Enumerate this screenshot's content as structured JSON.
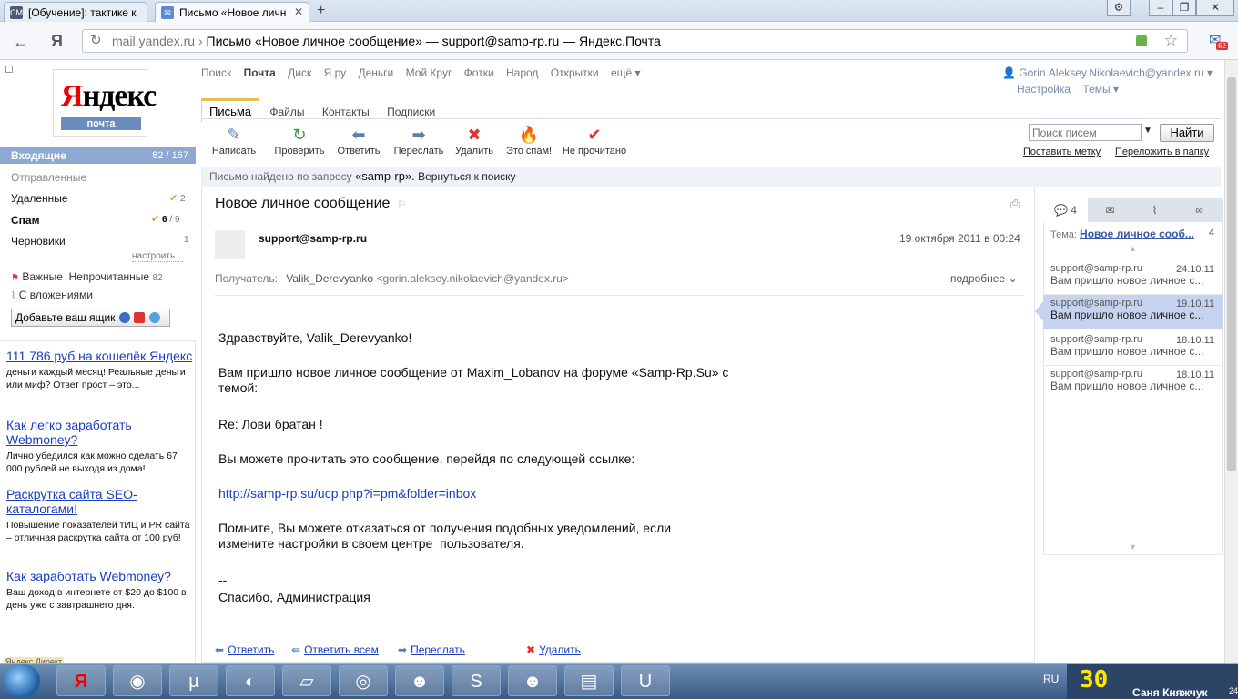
{
  "browser": {
    "tabs": [
      {
        "label": "[Обучение]: тактике к",
        "favicon": "СМ"
      },
      {
        "label": "Письмо «Новое личн",
        "favicon": "mail"
      }
    ],
    "url_host": "mail.yandex.ru",
    "url_title": "Письмо «Новое личное сообщение» — support@samp-rp.ru — Яндекс.Почта",
    "ext_count": "62"
  },
  "logo": {
    "word": "Яндекс",
    "first_letter": "Я",
    "rest": "ндекс",
    "sub": "почта"
  },
  "topnav": [
    "Поиск",
    "Почта",
    "Диск",
    "Я.ру",
    "Деньги",
    "Мой Круг",
    "Фотки",
    "Народ",
    "Открытки",
    "ещё ▾"
  ],
  "account": {
    "email": "Gorin.Aleksey.Nikolaevich@yandex.ru ▾",
    "settings": "Настройка",
    "themes": "Темы ▾"
  },
  "subtabs": [
    "Письма",
    "Файлы",
    "Контакты",
    "Подписки"
  ],
  "toolbar": [
    {
      "label": "Написать",
      "icon": "compose-icon"
    },
    {
      "label": "Проверить",
      "icon": "refresh-icon"
    },
    {
      "label": "Ответить",
      "icon": "reply-icon"
    },
    {
      "label": "Переслать",
      "icon": "forward-icon"
    },
    {
      "label": "Удалить",
      "icon": "delete-icon"
    },
    {
      "label": "Это спам!",
      "icon": "spam-icon"
    },
    {
      "label": "Не прочитано",
      "icon": "unread-icon"
    }
  ],
  "search": {
    "placeholder": "Поиск писем",
    "button": "Найти"
  },
  "toolbar_links": {
    "label": "Поставить метку",
    "move": "Переложить в папку"
  },
  "sidebar": {
    "inbox": {
      "label": "Входящие",
      "count": "82 / 167"
    },
    "sent": "Отправленные",
    "deleted": {
      "label": "Удаленные",
      "count": "2"
    },
    "spam": {
      "label": "Спам",
      "new": "6",
      "total": "/ 9"
    },
    "drafts": {
      "label": "Черновики",
      "count": "1"
    },
    "setup": "настроить...",
    "important": "Важные",
    "unread": "Непрочитанные",
    "unread_count": "82",
    "attachments": "С вложениями",
    "add_box": "Добавьте ваш ящик"
  },
  "ads": [
    {
      "title": "111 786 руб на кошелёк Яндекс",
      "text": "деньги каждый месяц! Реальные деньги или миф? Ответ прост – это..."
    },
    {
      "title": "Как легко заработать Webmoney?",
      "text": "Лично убедился как можно сделать 67 000 рублей не выходя из дома!"
    },
    {
      "title": "Раскрутка сайта SEO-каталогами!",
      "text": "Повышение показателей тИЦ и PR сайта – отличная раскрутка сайта от 100 руб!"
    },
    {
      "title": "Как заработать Webmoney?",
      "text": "Ваш доход в интернете от $20 до $100 в день уже с завтрашнего дня."
    }
  ],
  "ads_footer": "Яндекс.Директ",
  "found": {
    "prefix": "Письмо найдено по запросу",
    "query": "«samp-rp».",
    "back": "Вернуться к поиску"
  },
  "message": {
    "subject": "Новое личное сообщение",
    "from": "support@samp-rp.ru",
    "date": "19 октября 2011 в 00:24",
    "recipient_label": "Получатель:",
    "recipient_name": "Valik_Derevyanko",
    "recipient_email": "<gorin.aleksey.nikolaevich@yandex.ru>",
    "more": "подробнее ⌄",
    "greeting": "Здравствуйте, Valik_Derevyanko!",
    "line1": "Вам пришло новое личное сообщение от Maxim_Lobanov на форуме «Samp-Rp.Su» с\nтемой:",
    "line2": "Re: Лови братан !",
    "line3": "Вы можете прочитать это сообщение, перейдя по следующей ссылке:",
    "link": "http://samp-rp.su/ucp.php?i=pm&folder=inbox",
    "line4": "Помните, Вы можете отказаться от получения подобных уведомлений, если\nизмените настройки в своем центре  пользователя.",
    "sign_dash": "--",
    "signature": "Спасибо, Администрация"
  },
  "actions": {
    "reply": "Ответить",
    "reply_all": "Ответить всем",
    "forward": "Переслать",
    "delete": "Удалить"
  },
  "thread": {
    "tab_count": "4",
    "topic_label": "Тема:",
    "topic": "Новое личное сооб...",
    "topic_count": "4",
    "items": [
      {
        "from": "support@samp-rp.ru",
        "date": "24.10.11",
        "subject": "Вам пришло новое личное с..."
      },
      {
        "from": "support@samp-rp.ru",
        "date": "19.10.11",
        "subject": "Вам пришло новое личное с..."
      },
      {
        "from": "support@samp-rp.ru",
        "date": "18.10.11",
        "subject": "Вам пришло новое личное с..."
      },
      {
        "from": "support@samp-rp.ru",
        "date": "18.10.11",
        "subject": "Вам пришло новое личное с..."
      }
    ]
  },
  "taskbar": {
    "lang": "RU",
    "tray_number": "30",
    "user": "Саня Княжчук",
    "clock_fragment": "24"
  },
  "colors": {
    "inbox_bg": "#8da9d3",
    "selected_thread": "#c5d3ee",
    "link": "#1a3dc1",
    "yandex_red": "#e00000"
  }
}
